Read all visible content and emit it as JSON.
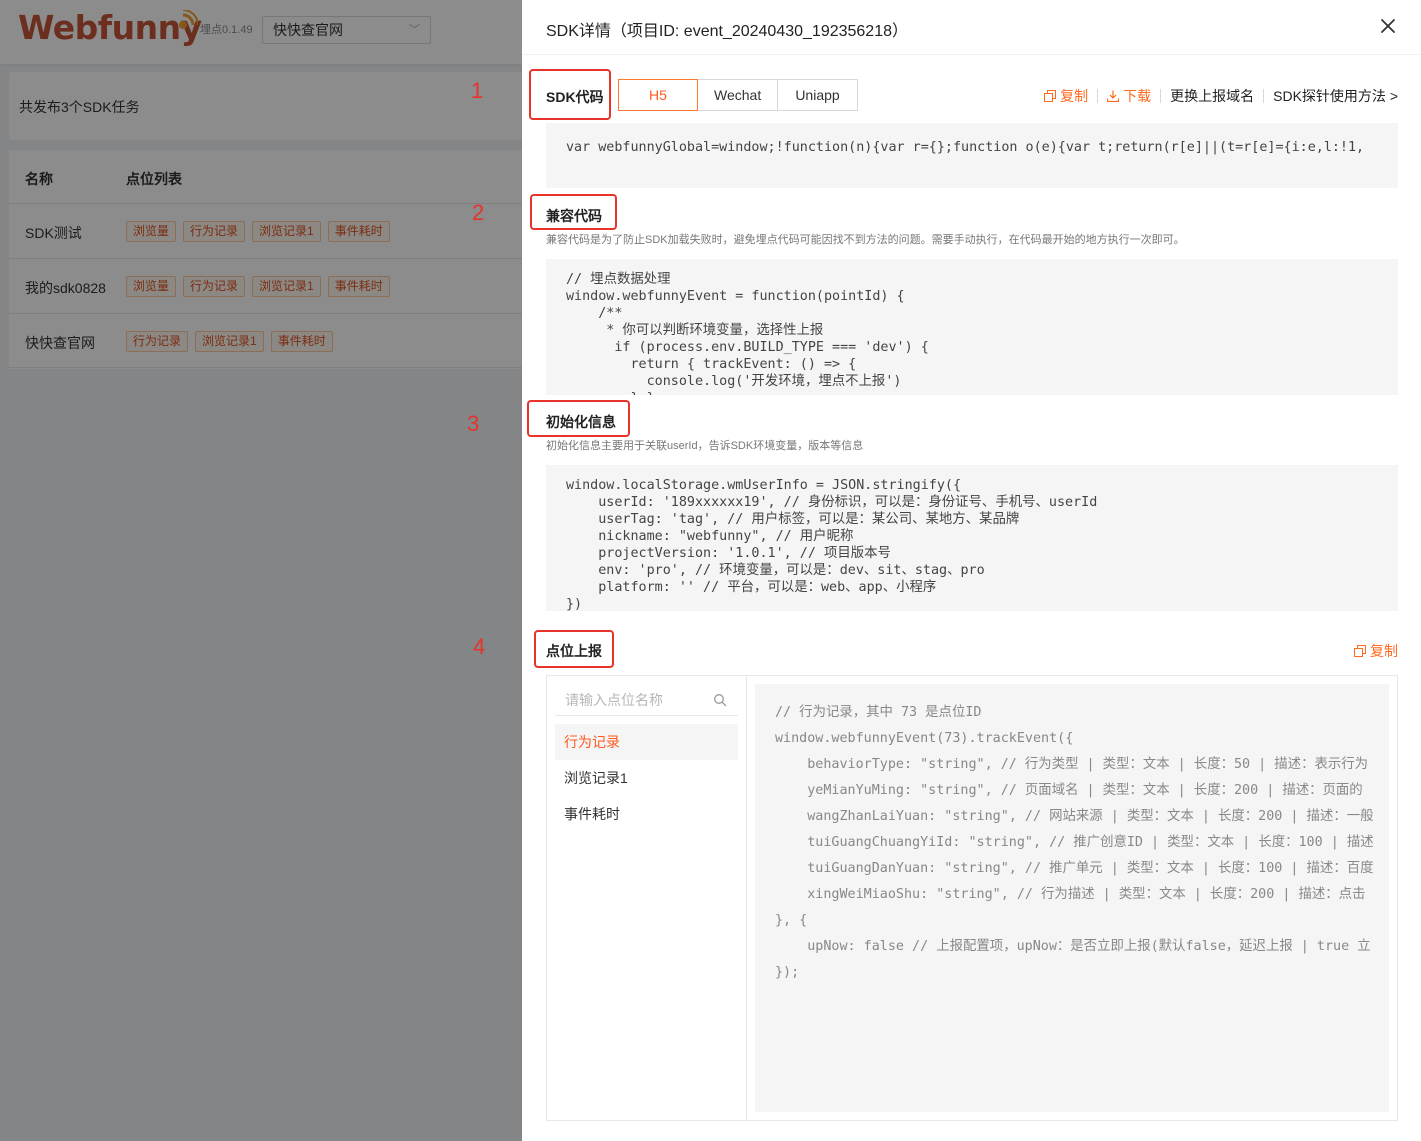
{
  "app": {
    "logo_text": "Webfunny",
    "version": "埋点0.1.49",
    "project_select": "快快查官网",
    "summary": "共发布3个SDK任务",
    "table": {
      "headers": [
        "名称",
        "点位列表"
      ],
      "rows": [
        {
          "name": "SDK测试",
          "tags": [
            "浏览量",
            "行为记录",
            "浏览记录1",
            "事件耗时"
          ]
        },
        {
          "name": "我的sdk0828",
          "tags": [
            "浏览量",
            "行为记录",
            "浏览记录1",
            "事件耗时"
          ]
        },
        {
          "name": "快快查官网",
          "tags": [
            "行为记录",
            "浏览记录1",
            "事件耗时"
          ]
        }
      ]
    }
  },
  "annotations": [
    "1",
    "2",
    "3",
    "4"
  ],
  "drawer": {
    "title": "SDK详情（项目ID: event_20240430_192356218）",
    "sdk_code": {
      "label": "SDK代码",
      "platforms": [
        "H5",
        "Wechat",
        "Uniapp"
      ],
      "active_platform": "H5",
      "actions": {
        "copy": "复制",
        "download": "下载",
        "change_domain": "更换上报域名",
        "probe_usage": "SDK探针使用方法 >"
      },
      "code": "var webfunnyGlobal=window;!function(n){var r={};function o(e){var t;return(r[e]||(t=r[e]={i:e,l:!1,"
    },
    "compat_code": {
      "label": "兼容代码",
      "desc": "兼容代码是为了防止SDK加载失败时，避免埋点代码可能因找不到方法的问题。需要手动执行，在代码最开始的地方执行一次即可。",
      "code": "// 埋点数据处理\nwindow.webfunnyEvent = function(pointId) {\n    /**\n     * 你可以判断环境变量，选择性上报\n      if (process.env.BUILD_TYPE === 'dev') {\n        return { trackEvent: () => {\n          console.log('开发环境，埋点不上报')\n        } }"
    },
    "init_info": {
      "label": "初始化信息",
      "desc": "初始化信息主要用于关联userId，告诉SDK环境变量，版本等信息",
      "code": "window.localStorage.wmUserInfo = JSON.stringify({\n    userId: '189xxxxxx19', // 身份标识，可以是：身份证号、手机号、userId\n    userTag: 'tag', // 用户标签，可以是：某公司、某地方、某品牌\n    nickname: \"webfunny\", // 用户昵称\n    projectVersion: '1.0.1', // 项目版本号\n    env: 'pro', // 环境变量，可以是：dev、sit、stag、pro\n    platform: '' // 平台，可以是：web、app、小程序\n})"
    },
    "point_report": {
      "label": "点位上报",
      "copy": "复制",
      "search_placeholder": "请输入点位名称",
      "events": [
        "行为记录",
        "浏览记录1",
        "事件耗时"
      ],
      "active_event": "行为记录",
      "code": "// 行为记录，其中 73 是点位ID\nwindow.webfunnyEvent(73).trackEvent({\n    behaviorType: \"string\", // 行为类型 | 类型：文本 | 长度：50 | 描述：表示行为\n    yeMianYuMing: \"string\", // 页面域名 | 类型：文本 | 长度：200 | 描述：页面的\n    wangZhanLaiYuan: \"string\", // 网站来源 | 类型：文本 | 长度：200 | 描述：一般\n    tuiGuangChuangYiId: \"string\", // 推广创意ID | 类型：文本 | 长度：100 | 描述\n    tuiGuangDanYuan: \"string\", // 推广单元 | 类型：文本 | 长度：100 | 描述：百度\n    xingWeiMiaoShu: \"string\", // 行为描述 | 类型：文本 | 长度：200 | 描述：点击\n}, {\n    upNow: false // 上报配置项，upNow：是否立即上报(默认false，延迟上报 | true 立\n});"
    }
  },
  "colors": {
    "accent": "#ff5a1f",
    "annotation": "#e8332a",
    "tag_text": "#e0531f"
  }
}
